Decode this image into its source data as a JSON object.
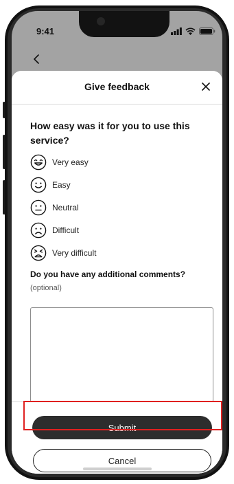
{
  "status_bar": {
    "time": "9:41",
    "icons": [
      "signal-icon",
      "wifi-icon",
      "battery-icon"
    ]
  },
  "nav": {
    "back_icon": "chevron-left-icon"
  },
  "sheet": {
    "title": "Give feedback",
    "close_icon": "close-icon"
  },
  "question": {
    "text": "How easy was it for you to use this service?"
  },
  "options": [
    {
      "label": "Very easy",
      "icon": "very-happy-face-icon"
    },
    {
      "label": "Easy",
      "icon": "happy-face-icon"
    },
    {
      "label": "Neutral",
      "icon": "neutral-face-icon"
    },
    {
      "label": "Difficult",
      "icon": "sad-face-icon"
    },
    {
      "label": "Very difficult",
      "icon": "very-sad-face-icon"
    }
  ],
  "comments": {
    "question": "Do you have any additional comments?",
    "hint": "(optional)",
    "value": "",
    "placeholder": ""
  },
  "actions": {
    "submit_label": "Submit",
    "cancel_label": "Cancel"
  },
  "colors": {
    "screen_background": "#a3a3a3",
    "primary_button": "#2d2d2d",
    "highlight": "#e0201f"
  }
}
